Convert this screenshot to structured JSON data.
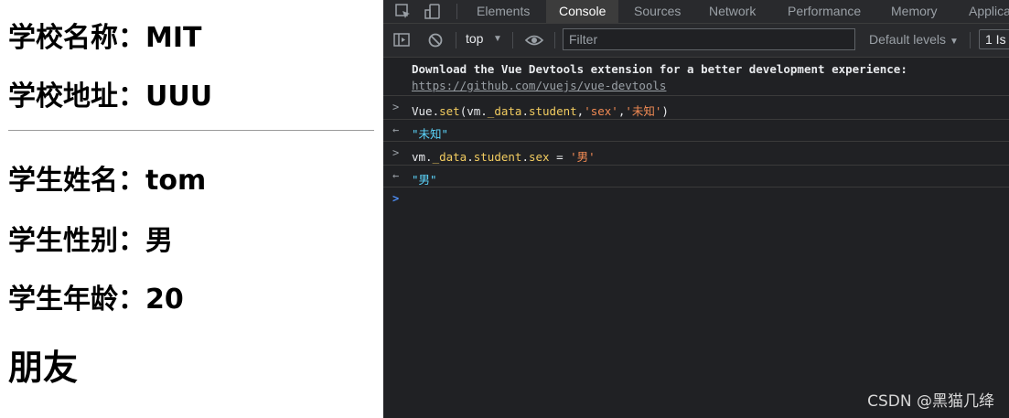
{
  "page": {
    "school_name": "学校名称：MIT",
    "school_address": "学校地址：UUU",
    "student_name": "学生姓名：tom",
    "student_sex": "学生性别：男",
    "student_age": "学生年龄：20",
    "friends_heading": "朋友"
  },
  "devtools": {
    "tabs": [
      "Elements",
      "Console",
      "Sources",
      "Network",
      "Performance",
      "Memory",
      "Applica"
    ],
    "active_tab": "Console",
    "toolbar": {
      "context": "top",
      "filter_placeholder": "Filter",
      "levels": "Default levels",
      "issues": "1 Is"
    },
    "console": {
      "info_line1": "Download the Vue Devtools extension for a better development experience:",
      "info_link": "https://github.com/vuejs/vue-devtools",
      "cmd1": {
        "obj": "Vue.",
        "fn": "set",
        "args_pre": "(vm.",
        "prop1": "_data",
        "dot": ".",
        "prop2": "student",
        "comma1": ",",
        "str1": "'sex'",
        "comma2": ",",
        "str2": "'未知'",
        "close": ")"
      },
      "result1": "\"未知\"",
      "cmd2": {
        "pre": "vm.",
        "prop1": "_data",
        "dot1": ".",
        "prop2": "student",
        "dot2": ".",
        "prop3": "sex",
        "op": " = ",
        "str": "'男'"
      },
      "result2": "\"男\""
    },
    "colors": {
      "background": "#202124",
      "string": "#f28b54",
      "property": "#f2cc60",
      "result": "#5cd5fb",
      "prompt": "#4e8ef7"
    }
  },
  "watermark": "CSDN @黑猫几绛"
}
